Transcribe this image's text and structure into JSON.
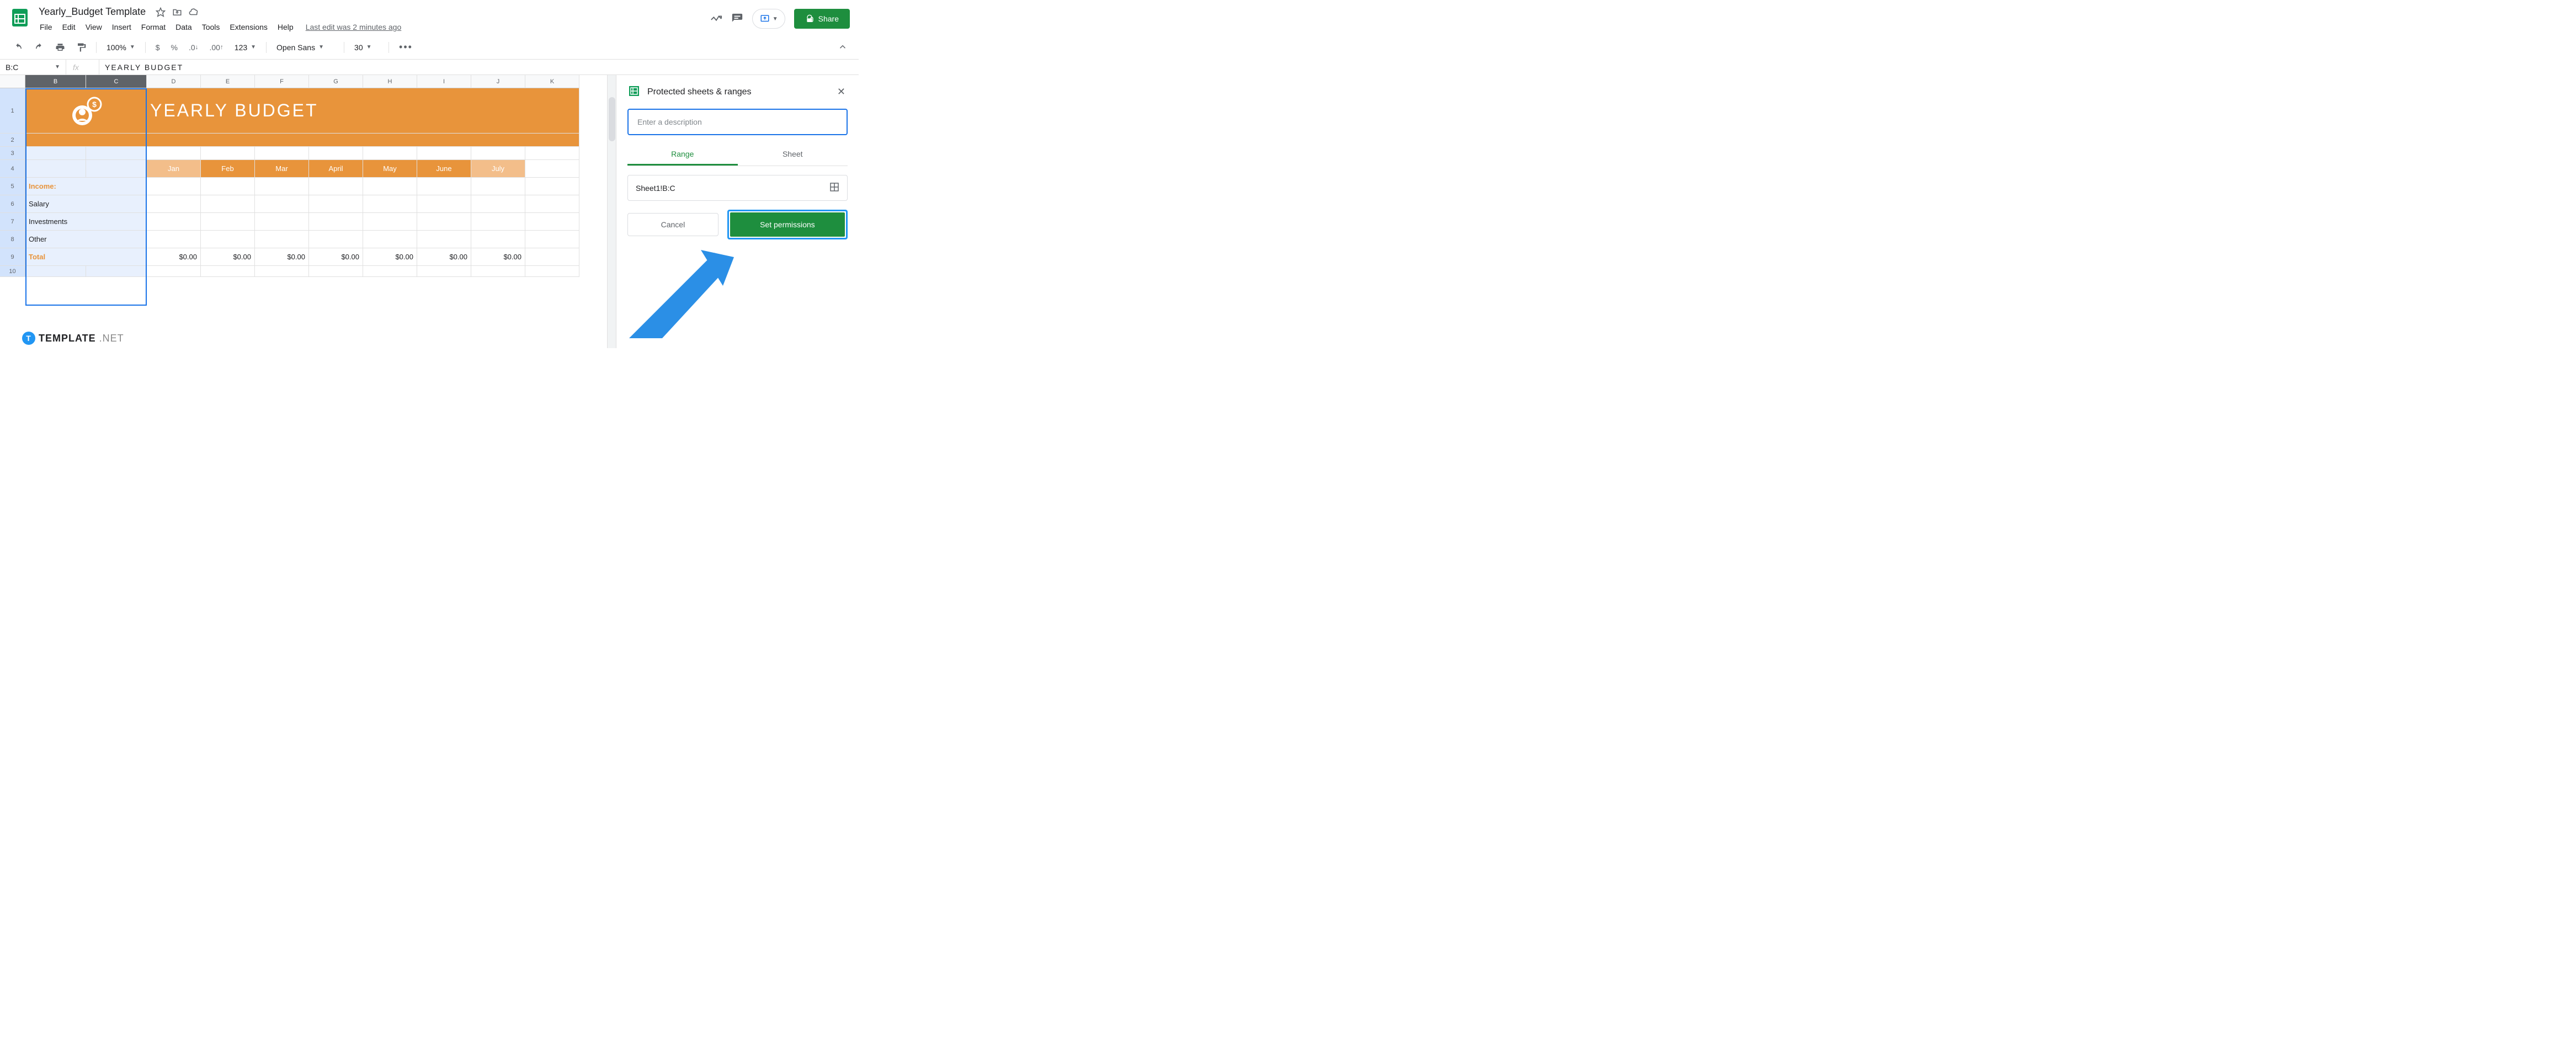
{
  "doc": {
    "title": "Yearly_Budget Template",
    "last_edit": "Last edit was 2 minutes ago"
  },
  "menu": {
    "file": "File",
    "edit": "Edit",
    "view": "View",
    "insert": "Insert",
    "format": "Format",
    "data": "Data",
    "tools": "Tools",
    "extensions": "Extensions",
    "help": "Help"
  },
  "share": {
    "label": "Share"
  },
  "toolbar": {
    "zoom": "100%",
    "currency": "$",
    "percent": "%",
    "dec_dec": ".0",
    "inc_dec": ".00",
    "num_format": "123",
    "font": "Open Sans",
    "font_size": "30"
  },
  "formula": {
    "name_box": "B:C",
    "fx": "fx",
    "value": "YEARLY  BUDGET"
  },
  "columns": [
    "B",
    "C",
    "D",
    "E",
    "F",
    "G",
    "H",
    "I",
    "J",
    "K"
  ],
  "rows": [
    "1",
    "2",
    "3",
    "4",
    "5",
    "6",
    "7",
    "8",
    "9",
    "10"
  ],
  "sheet": {
    "banner_title": "YEARLY  BUDGET",
    "months": [
      "Jan",
      "Feb",
      "Mar",
      "April",
      "May",
      "June",
      "July"
    ],
    "income_label": "Income:",
    "income_rows": [
      "Salary",
      "Investments",
      "Other"
    ],
    "total_label": "Total",
    "total_values": [
      "$0.00",
      "$0.00",
      "$0.00",
      "$0.00",
      "$0.00",
      "$0.00",
      "$0.00"
    ]
  },
  "panel": {
    "title": "Protected sheets & ranges",
    "desc_placeholder": "Enter a description",
    "tab_range": "Range",
    "tab_sheet": "Sheet",
    "range_value": "Sheet1!B:C",
    "cancel": "Cancel",
    "set_permissions": "Set permissions"
  },
  "watermark": {
    "brand": "TEMPLATE",
    "suffix": ".NET",
    "badge": "T"
  }
}
